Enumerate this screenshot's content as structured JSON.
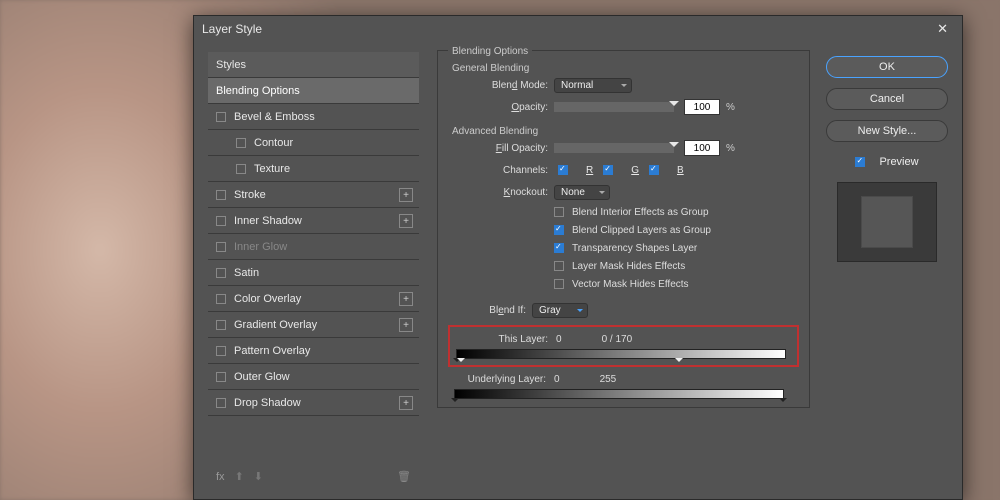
{
  "dialog": {
    "title": "Layer Style"
  },
  "left": {
    "header": "Styles",
    "items": [
      {
        "label": "Blending Options",
        "active": true,
        "check": false
      },
      {
        "label": "Bevel & Emboss",
        "check": true,
        "plus": false,
        "checked": false
      },
      {
        "label": "Contour",
        "indent": true,
        "check": true,
        "checked": false
      },
      {
        "label": "Texture",
        "indent": true,
        "check": true,
        "checked": false
      },
      {
        "label": "Stroke",
        "check": true,
        "plus": true,
        "checked": false
      },
      {
        "label": "Inner Shadow",
        "check": true,
        "plus": true,
        "checked": false
      },
      {
        "label": "Inner Glow",
        "check": true,
        "checked": false,
        "dim": true
      },
      {
        "label": "Satin",
        "check": true,
        "checked": false
      },
      {
        "label": "Color Overlay",
        "check": true,
        "plus": true,
        "checked": false
      },
      {
        "label": "Gradient Overlay",
        "check": true,
        "plus": true,
        "checked": false
      },
      {
        "label": "Pattern Overlay",
        "check": true,
        "checked": false
      },
      {
        "label": "Outer Glow",
        "check": true,
        "checked": false
      },
      {
        "label": "Drop Shadow",
        "check": true,
        "plus": true,
        "checked": false
      }
    ],
    "footer_fx": "fx"
  },
  "mid": {
    "panel_title": "Blending Options",
    "general": {
      "legend": "General Blending",
      "blend_mode_label": "Blend Mode:",
      "blend_mode_value": "Normal",
      "opacity_label": "Opacity:",
      "opacity_value": "100",
      "pct": "%"
    },
    "advanced": {
      "legend": "Advanced Blending",
      "fill_opacity_label": "Fill Opacity:",
      "fill_opacity_value": "100",
      "pct": "%",
      "channels_label": "Channels:",
      "ch_r": "R",
      "ch_g": "G",
      "ch_b": "B",
      "knockout_label": "Knockout:",
      "knockout_value": "None",
      "opt1": "Blend Interior Effects as Group",
      "opt2": "Blend Clipped Layers as Group",
      "opt3": "Transparency Shapes Layer",
      "opt4": "Layer Mask Hides Effects",
      "opt5": "Vector Mask Hides Effects",
      "opt2_checked": true,
      "opt3_checked": true
    },
    "blendif": {
      "label": "Blend If:",
      "value": "Gray",
      "this_layer_label": "This Layer:",
      "this_black": "0",
      "this_white": "0   /   170",
      "underlying_label": "Underlying Layer:",
      "under_black": "0",
      "under_white": "255"
    }
  },
  "right": {
    "ok": "OK",
    "cancel": "Cancel",
    "new_style": "New Style...",
    "preview": "Preview"
  }
}
